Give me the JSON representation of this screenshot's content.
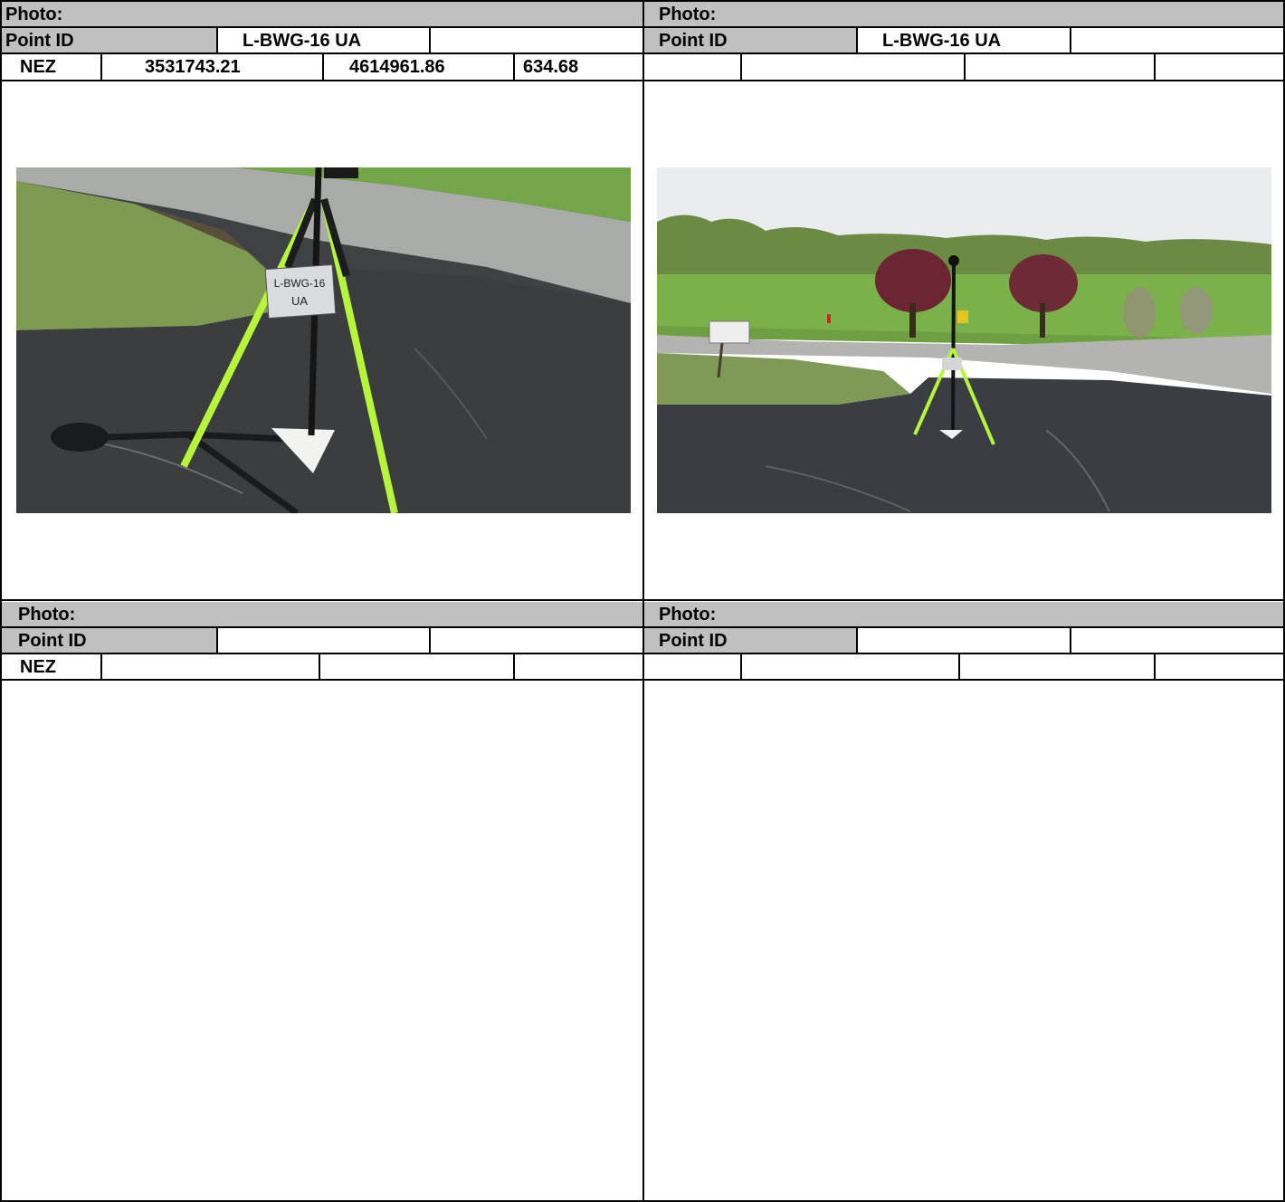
{
  "panels": [
    {
      "photo_label": "Photo:",
      "point_id_label": "Point ID",
      "point_id_value": "L-BWG-16 UA",
      "nez_label": "NEZ",
      "northing": "3531743.21",
      "easting": "4614961.86",
      "elevation": "634.68",
      "sign_text_line1": "L-BWG-16",
      "sign_text_line2": "UA"
    },
    {
      "photo_label": "Photo:",
      "point_id_label": "Point ID",
      "point_id_value": "L-BWG-16 UA"
    },
    {
      "photo_label": "Photo:",
      "point_id_label": "Point ID",
      "point_id_value": "",
      "nez_label": "NEZ"
    },
    {
      "photo_label": "Photo:",
      "point_id_label": "Point ID",
      "point_id_value": ""
    }
  ],
  "colors": {
    "header_gray": "#c0c0c0",
    "grid_line": "#000000",
    "pole_green": "#b6f53a"
  }
}
